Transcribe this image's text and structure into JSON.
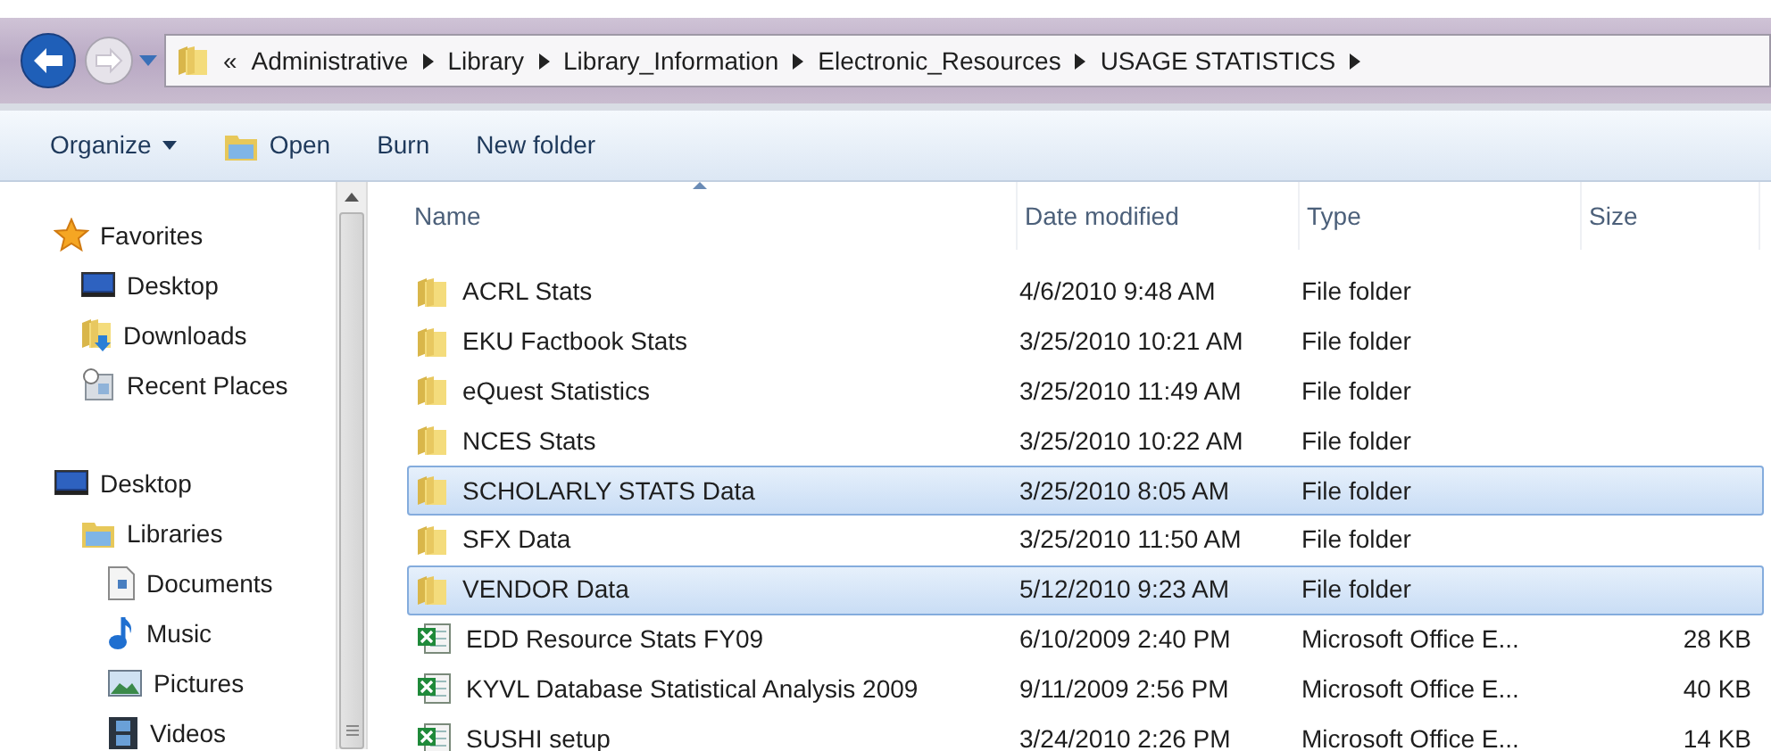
{
  "address_bar": {
    "overflow_marker": "«",
    "segments": [
      "Administrative",
      "Library",
      "Library_Information",
      "Electronic_Resources",
      "USAGE STATISTICS"
    ]
  },
  "toolbar": [
    {
      "label": "Organize",
      "kind": "menu"
    },
    {
      "label": "Open",
      "kind": "open"
    },
    {
      "label": "Burn",
      "kind": "plain"
    },
    {
      "label": "New folder",
      "kind": "plain"
    }
  ],
  "sidebar": {
    "sections": [
      {
        "label": "Favorites",
        "kind": "star",
        "children": [
          {
            "label": "Desktop",
            "kind": "desktop"
          },
          {
            "label": "Downloads",
            "kind": "downloads"
          },
          {
            "label": "Recent Places",
            "kind": "recent"
          }
        ]
      },
      {
        "label": "Desktop",
        "kind": "desktop",
        "children": [
          {
            "label": "Libraries",
            "kind": "libraries",
            "children": [
              {
                "label": "Documents",
                "kind": "documents"
              },
              {
                "label": "Music",
                "kind": "music"
              },
              {
                "label": "Pictures",
                "kind": "pictures"
              },
              {
                "label": "Videos",
                "kind": "videos"
              }
            ]
          }
        ]
      }
    ]
  },
  "table": {
    "columns": [
      "Name",
      "Date modified",
      "Type",
      "Size"
    ],
    "rows": [
      {
        "kind": "folder",
        "selected": false,
        "name": "ACRL Stats",
        "date": "4/6/2010 9:48 AM",
        "type": "File folder"
      },
      {
        "kind": "folder",
        "selected": false,
        "name": "EKU Factbook Stats",
        "date": "3/25/2010 10:21 AM",
        "type": "File folder"
      },
      {
        "kind": "folder",
        "selected": false,
        "name": "eQuest Statistics",
        "date": "3/25/2010 11:49 AM",
        "type": "File folder"
      },
      {
        "kind": "folder",
        "selected": false,
        "name": "NCES Stats",
        "date": "3/25/2010 10:22 AM",
        "type": "File folder"
      },
      {
        "kind": "folder",
        "selected": true,
        "name": "SCHOLARLY STATS Data",
        "date": "3/25/2010 8:05 AM",
        "type": "File folder"
      },
      {
        "kind": "folder",
        "selected": false,
        "name": "SFX Data",
        "date": "3/25/2010 11:50 AM",
        "type": "File folder"
      },
      {
        "kind": "folder",
        "selected": true,
        "name": "VENDOR Data",
        "date": "5/12/2010 9:23 AM",
        "type": "File folder"
      },
      {
        "kind": "spreadsheet",
        "selected": false,
        "name": "EDD Resource Stats FY09",
        "date": "6/10/2009 2:40 PM",
        "type": "Microsoft Office E...",
        "size": "28 KB"
      },
      {
        "kind": "spreadsheet",
        "selected": false,
        "name": "KYVL Database Statistical Analysis 2009",
        "date": "9/11/2009 2:56 PM",
        "type": "Microsoft Office E...",
        "size": "40 KB"
      },
      {
        "kind": "spreadsheet",
        "selected": false,
        "name": "SUSHI setup",
        "date": "3/24/2010 2:26 PM",
        "type": "Microsoft Office E...",
        "size": "14 KB"
      }
    ]
  }
}
